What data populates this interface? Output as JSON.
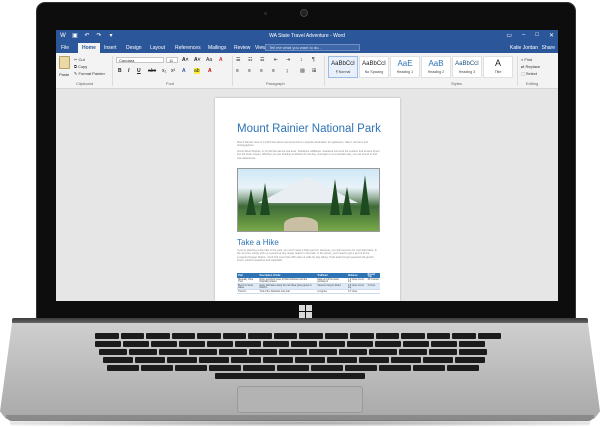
{
  "word": {
    "title": "WA State Travel Adventure - Word",
    "tabs": [
      "File",
      "Home",
      "Insert",
      "Design",
      "Layout",
      "References",
      "Mailings",
      "Review",
      "View"
    ],
    "active_tab": "Home",
    "tell_me": "Tell me what you want to do...",
    "user": "Katie Jordan",
    "share": "Share"
  },
  "ribbon": {
    "clipboard": {
      "label": "Clipboard",
      "paste": "Paste",
      "cut": "Cut",
      "copy": "Copy",
      "format_painter": "Format Painter"
    },
    "font": {
      "label": "Font",
      "name": "Candara",
      "size": "11"
    },
    "paragraph": {
      "label": "Paragraph"
    },
    "styles": {
      "label": "Styles",
      "items": [
        {
          "sample": "AaBbCcI",
          "name": "¶ Normal"
        },
        {
          "sample": "AaBbCcI",
          "name": "No Spacing"
        },
        {
          "sample": "AaE",
          "name": "Heading 1"
        },
        {
          "sample": "AaB",
          "name": "Heading 2"
        },
        {
          "sample": "AaBbCcI",
          "name": "Heading 3"
        },
        {
          "sample": "A",
          "name": "Title"
        }
      ]
    },
    "editing": {
      "label": "Editing",
      "find": "Find",
      "replace": "Replace",
      "select": "Select"
    }
  },
  "document": {
    "title": "Mount Rainier National Park",
    "para1": "Mount Rainier rises to 14,410 feet above sea level and is a popular destination for sightseers, hikers, climbers and photographers.",
    "para2": "Iconic Mount Rainier, is 14,410 feet above sea level. Subalpine wildflower meadows surround the volcano and ancient forest line the lower slopes. Whether you are heading to Rainier for the day, overnight or an extended stay, you are bound to find new adventures.",
    "heading": "Take a Hike",
    "hike_para": "If you're planning a day hike in the park, you won't need a hiking permit. However, you will need one for overnight hikes. In the summer, simply pick up a permit at any ranger station in the park. In the winter, you'll need to get a permit at the Longmire Ranger Station. You'll find more than 260 miles of trails for day hiking. Trails lead through peaceful old-growth forest, colorful meadows and waterfalls.",
    "table": {
      "headers": [
        "Trail",
        "Description of Hike",
        "Trailhead",
        "Distance",
        "Round Trip"
      ],
      "rows": [
        [
          "Nisqually Vista Trail",
          "Enjoy excellent views of Mount Rainier and the Nisqually Glacier.",
          "East end of the lower parking lot",
          "1.2 miles round trip",
          "45 minutes"
        ],
        [
          "Bench & Snow Lakes",
          "Enjoy wild lakes along the trail. Bear grass grows in blooms.",
          "Stevens Canyon Road",
          "2.5 miles round trip",
          "2 hours"
        ],
        [
          "Trail of t.",
          "Trail of the Shadows loop trail.",
          "Longmire",
          "0.7 miles",
          ""
        ]
      ]
    }
  }
}
